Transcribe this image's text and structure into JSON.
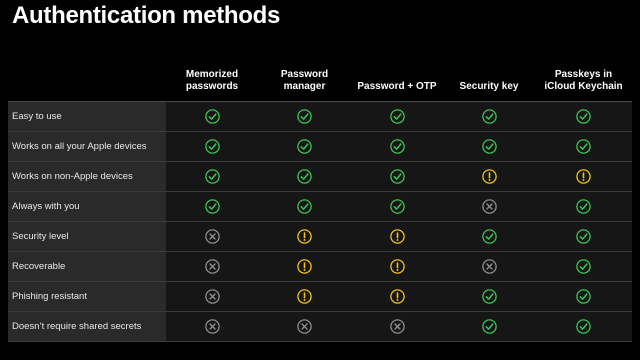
{
  "title": "Authentication methods",
  "colors": {
    "background": "#000000",
    "yes": "#3cc552",
    "warn": "#f2c21b",
    "no": "#8e8e93"
  },
  "columns": [
    {
      "line1": "Memorized",
      "line2": "passwords"
    },
    {
      "line1": "",
      "line2": "Password manager"
    },
    {
      "line1": "",
      "line2": "Password + OTP"
    },
    {
      "line1": "",
      "line2": "Security key"
    },
    {
      "line1": "Passkeys in",
      "line2": "iCloud Keychain"
    }
  ],
  "rows": [
    {
      "label": "Easy to use",
      "cells": [
        "yes",
        "yes",
        "yes",
        "yes",
        "yes"
      ]
    },
    {
      "label": "Works on all your Apple devices",
      "cells": [
        "yes",
        "yes",
        "yes",
        "yes",
        "yes"
      ]
    },
    {
      "label": "Works on non-Apple devices",
      "cells": [
        "yes",
        "yes",
        "yes",
        "warn",
        "warn"
      ]
    },
    {
      "label": "Always with you",
      "cells": [
        "yes",
        "yes",
        "yes",
        "no",
        "yes"
      ]
    },
    {
      "label": "Security level",
      "cells": [
        "no",
        "warn",
        "warn",
        "yes",
        "yes"
      ]
    },
    {
      "label": "Recoverable",
      "cells": [
        "no",
        "warn",
        "warn",
        "no",
        "yes"
      ]
    },
    {
      "label": "Phishing resistant",
      "cells": [
        "no",
        "warn",
        "warn",
        "yes",
        "yes"
      ]
    },
    {
      "label": "Doesn’t require shared secrets",
      "cells": [
        "no",
        "no",
        "no",
        "yes",
        "yes"
      ]
    }
  ],
  "icon_names": {
    "yes": "checkmark-circle-icon",
    "warn": "exclamation-circle-icon",
    "no": "x-circle-icon"
  }
}
